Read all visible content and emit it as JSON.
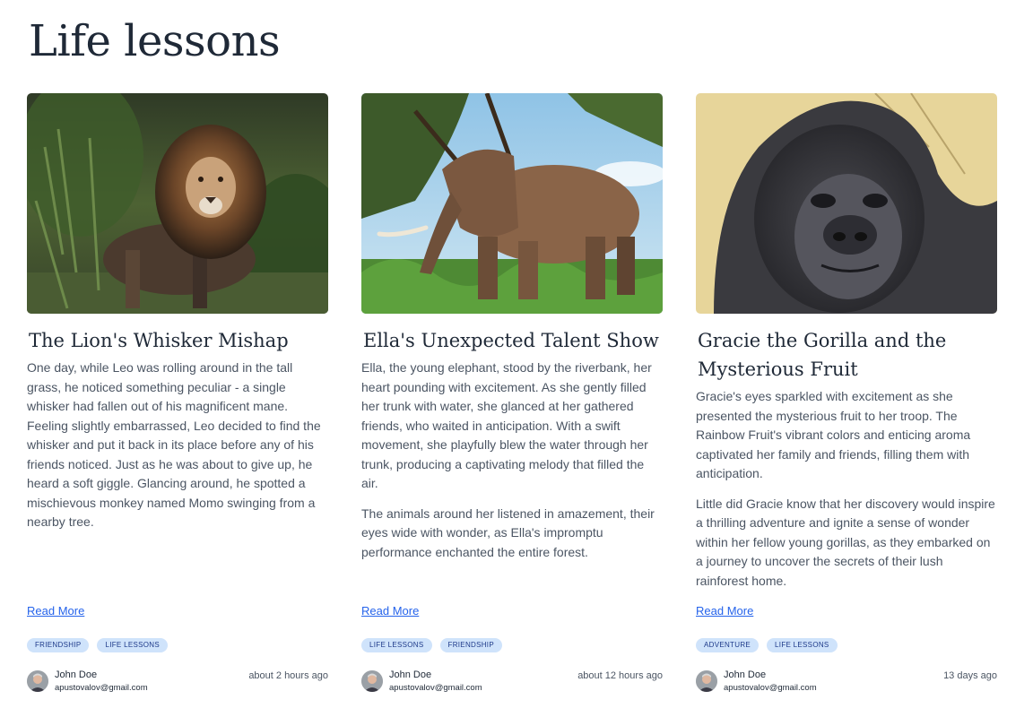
{
  "page": {
    "title": "Life lessons"
  },
  "cards": [
    {
      "image_alt": "Lion",
      "title": "The Lion's Whisker Mishap",
      "paragraphs": [
        "One day, while Leo was rolling around in the tall grass, he noticed something peculiar - a single whisker had fallen out of his magnificent mane. Feeling slightly embarrassed, Leo decided to find the whisker and put it back in its place before any of his friends noticed. Just as he was about to give up, he heard a soft giggle. Glancing around, he spotted a mischievous monkey named Momo swinging from a nearby tree."
      ],
      "read_more": "Read More",
      "tags": [
        "FRIENDSHIP",
        "LIFE LESSONS"
      ],
      "author": {
        "name": "John Doe",
        "email": "apustovalov@gmail.com"
      },
      "timestamp": "about 2 hours ago"
    },
    {
      "image_alt": "Elephant",
      "title": "Ella's Unexpected Talent Show",
      "paragraphs": [
        "Ella, the young elephant, stood by the riverbank, her heart pounding with excitement. As she gently filled her trunk with water, she glanced at her gathered friends, who waited in anticipation. With a swift movement, she playfully blew the water through her trunk, producing a captivating melody that filled the air.",
        "The animals around her listened in amazement, their eyes wide with wonder, as Ella's impromptu performance enchanted the entire forest."
      ],
      "read_more": "Read More",
      "tags": [
        "LIFE LESSONS",
        "FRIENDSHIP"
      ],
      "author": {
        "name": "John Doe",
        "email": "apustovalov@gmail.com"
      },
      "timestamp": "about 12 hours ago"
    },
    {
      "image_alt": "Gorilla",
      "title": "Gracie the Gorilla and the Mysterious Fruit",
      "paragraphs": [
        "Gracie's eyes sparkled with excitement as she presented the mysterious fruit to her troop. The Rainbow Fruit's vibrant colors and enticing aroma captivated her family and friends, filling them with anticipation.",
        "Little did Gracie know that her discovery would inspire a thrilling adventure and ignite a sense of wonder within her fellow young gorillas, as they embarked on a journey to uncover the secrets of their lush rainforest home."
      ],
      "read_more": "Read More",
      "tags": [
        "ADVENTURE",
        "LIFE LESSONS"
      ],
      "author": {
        "name": "John Doe",
        "email": "apustovalov@gmail.com"
      },
      "timestamp": "13 days ago"
    }
  ],
  "colors": {
    "link": "#2563eb",
    "tag_bg": "#cfe3fb",
    "tag_text": "#1e3a8a",
    "body_text": "#4b5563"
  }
}
